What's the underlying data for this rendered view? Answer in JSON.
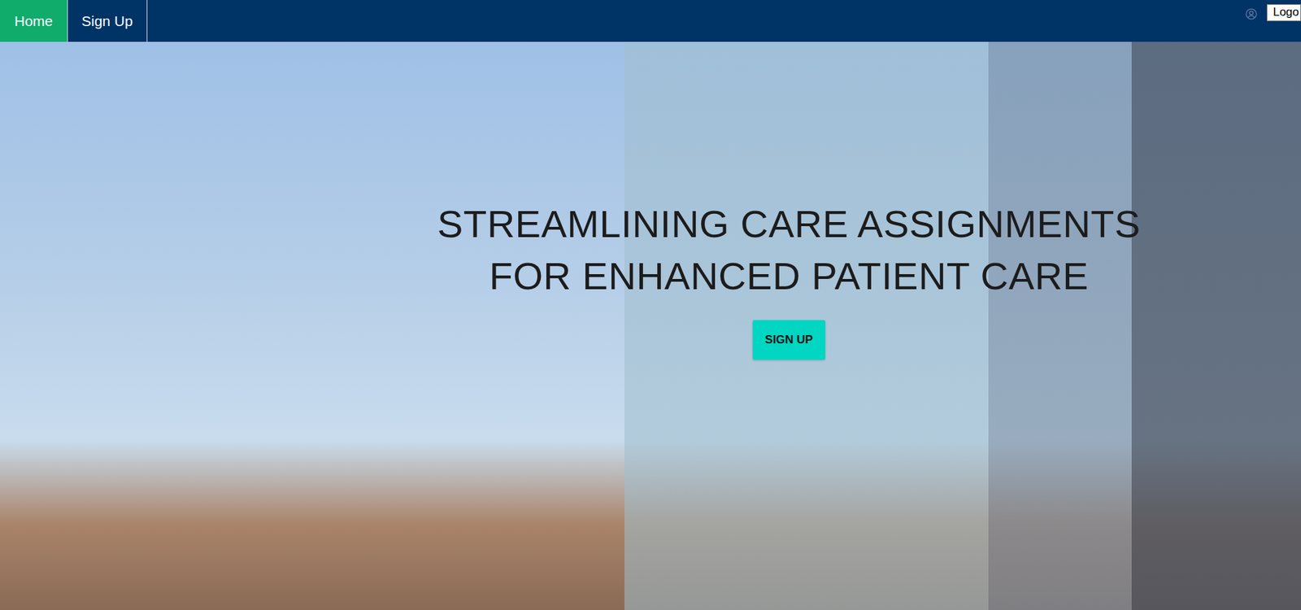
{
  "nav": {
    "tabs": [
      {
        "label": "Home",
        "selected": true
      },
      {
        "label": "Sign Up",
        "selected": false
      }
    ],
    "logo_button": "Logo"
  },
  "hero": {
    "heading_lines": [
      "STREAMLINING CARE ASSIGNMENTS",
      "FOR ENHANCED PATIENT CARE"
    ],
    "button": "SIGN UP"
  }
}
